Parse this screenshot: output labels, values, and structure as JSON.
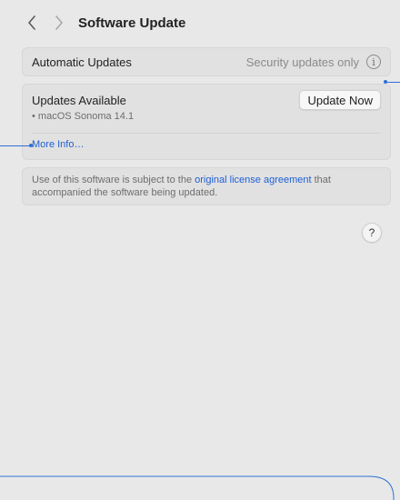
{
  "header": {
    "title": "Software Update",
    "back_icon": "chevron-left-icon",
    "forward_icon": "chevron-right-icon"
  },
  "automatic_updates": {
    "label": "Automatic Updates",
    "value": "Security updates only",
    "info_glyph": "i"
  },
  "updates": {
    "heading": "Updates Available",
    "items": [
      "• macOS Sonoma 14.1"
    ],
    "update_button": "Update Now",
    "more_info": "More Info…"
  },
  "license": {
    "text_before": "Use of this software is subject to the ",
    "link": "original license agreement",
    "text_after": " that accompanied the software being updated."
  },
  "help": {
    "glyph": "?"
  },
  "colors": {
    "accent": "#2f6fd6",
    "link": "#1f5fd6",
    "background": "#e8e8e8"
  }
}
